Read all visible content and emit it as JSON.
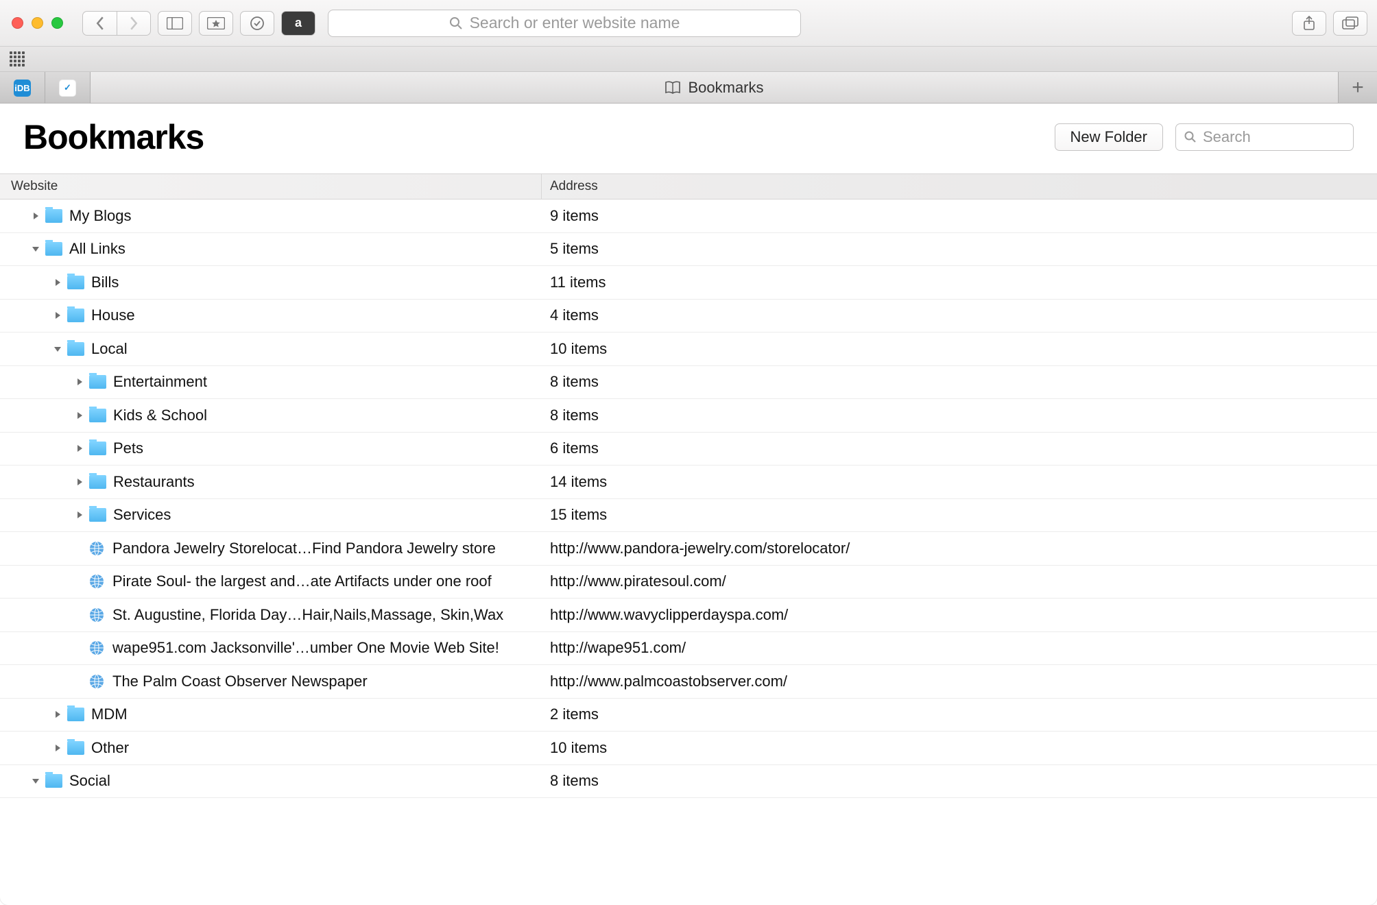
{
  "urlbar_placeholder": "Search or enter website name",
  "tab_title": "Bookmarks",
  "minitabs": [
    "iDB",
    "✓"
  ],
  "page_title": "Bookmarks",
  "new_folder_label": "New Folder",
  "bookmark_search_placeholder": "Search",
  "columns": {
    "website": "Website",
    "address": "Address"
  },
  "rows": [
    {
      "depth": 0,
      "kind": "folder",
      "arrow": "right",
      "name": "My Blogs",
      "address": "9 items"
    },
    {
      "depth": 0,
      "kind": "folder",
      "arrow": "down",
      "name": "All Links",
      "address": "5 items"
    },
    {
      "depth": 1,
      "kind": "folder",
      "arrow": "right",
      "name": "Bills",
      "address": "11 items"
    },
    {
      "depth": 1,
      "kind": "folder",
      "arrow": "right",
      "name": "House",
      "address": "4 items"
    },
    {
      "depth": 1,
      "kind": "folder",
      "arrow": "down",
      "name": "Local",
      "address": "10 items"
    },
    {
      "depth": 2,
      "kind": "folder",
      "arrow": "right",
      "name": "Entertainment",
      "address": "8 items"
    },
    {
      "depth": 2,
      "kind": "folder",
      "arrow": "right",
      "name": "Kids & School",
      "address": "8 items"
    },
    {
      "depth": 2,
      "kind": "folder",
      "arrow": "right",
      "name": "Pets",
      "address": "6 items"
    },
    {
      "depth": 2,
      "kind": "folder",
      "arrow": "right",
      "name": "Restaurants",
      "address": "14 items"
    },
    {
      "depth": 2,
      "kind": "folder",
      "arrow": "right",
      "name": "Services",
      "address": "15 items"
    },
    {
      "depth": 2,
      "kind": "bookmark",
      "name": "Pandora Jewelry Storelocat…Find Pandora Jewelry store",
      "address": "http://www.pandora-jewelry.com/storelocator/"
    },
    {
      "depth": 2,
      "kind": "bookmark",
      "name": "Pirate Soul- the largest and…ate Artifacts under one roof",
      "address": "http://www.piratesoul.com/"
    },
    {
      "depth": 2,
      "kind": "bookmark",
      "name": "St. Augustine, Florida Day…Hair,Nails,Massage, Skin,Wax",
      "address": "http://www.wavyclipperdayspa.com/"
    },
    {
      "depth": 2,
      "kind": "bookmark",
      "name": "wape951.com Jacksonville'…umber One Movie Web Site!",
      "address": "http://wape951.com/"
    },
    {
      "depth": 2,
      "kind": "bookmark",
      "name": "The Palm Coast Observer Newspaper",
      "address": "http://www.palmcoastobserver.com/"
    },
    {
      "depth": 1,
      "kind": "folder",
      "arrow": "right",
      "name": "MDM",
      "address": "2 items"
    },
    {
      "depth": 1,
      "kind": "folder",
      "arrow": "right",
      "name": "Other",
      "address": "10 items"
    },
    {
      "depth": 0,
      "kind": "folder",
      "arrow": "down",
      "name": "Social",
      "address": "8 items"
    }
  ]
}
